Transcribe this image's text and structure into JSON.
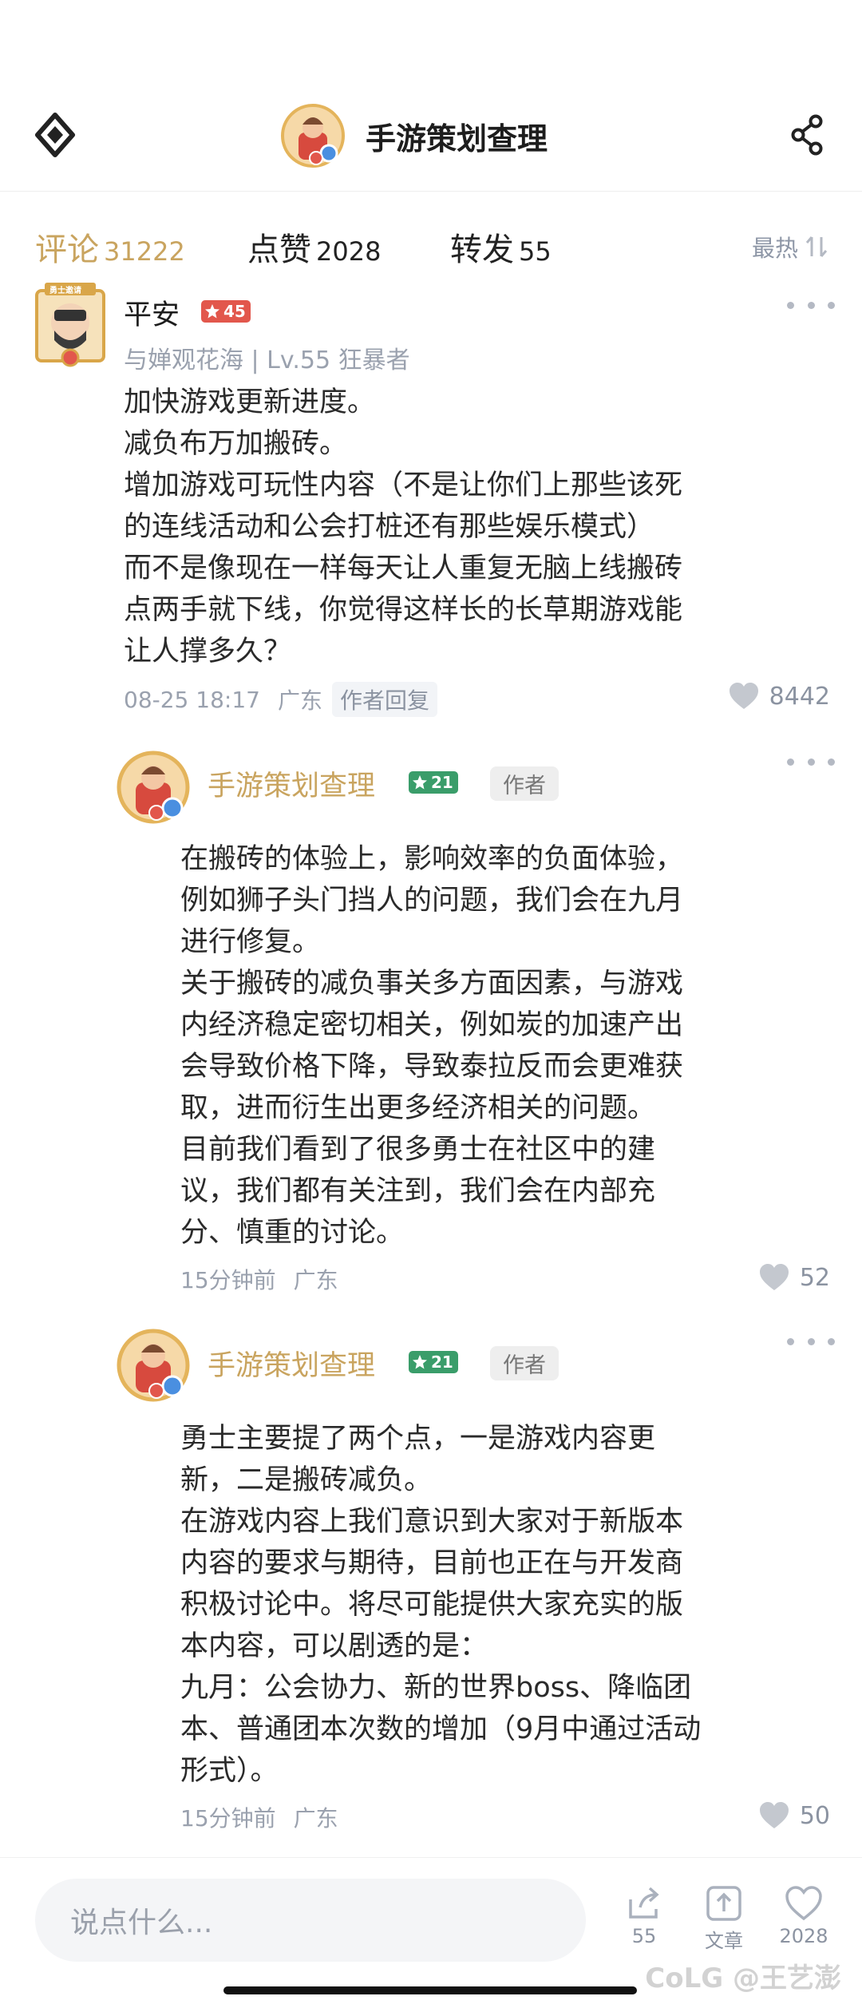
{
  "header": {
    "title": "手游策划查理",
    "back_icon": "diamond-logo-icon",
    "share_icon": "share-icon"
  },
  "tabs": [
    {
      "label": "评论",
      "count": "31222",
      "active": true
    },
    {
      "label": "点赞",
      "count": "2028",
      "active": false
    },
    {
      "label": "转发",
      "count": "55",
      "active": false
    }
  ],
  "sort_label": "最热",
  "colors": {
    "accent": "#c9a45f",
    "meta": "#9aa1ae",
    "badge_red": "#e2574c",
    "badge_green": "#3a9d6a"
  },
  "comment": {
    "username": "平安",
    "level_badge": "45",
    "avatar_banner": "勇士邀请",
    "sub": "与婵观花海 | Lv.55 狂暴者",
    "lines": [
      "加快游戏更新进度。",
      "减负布万加搬砖。",
      "增加游戏可玩性内容（不是让你们上那些该死",
      "的连线活动和公会打桩还有那些娱乐模式）",
      "而不是像现在一样每天让人重复无脑上线搬砖",
      "点两手就下线，你觉得这样长的长草期游戏能",
      "让人撑多久？"
    ],
    "time": "08-25 18:17",
    "region": "广东",
    "reply_tag": "作者回复",
    "likes": "8442"
  },
  "replies": [
    {
      "username": "手游策划查理",
      "level_badge": "21",
      "author_tag": "作者",
      "lines": [
        "在搬砖的体验上，影响效率的负面体验，",
        "例如狮子头门挡人的问题，我们会在九月",
        "进行修复。",
        "关于搬砖的减负事关多方面因素，与游戏",
        "内经济稳定密切相关，例如炭的加速产出",
        "会导致价格下降，导致泰拉反而会更难获",
        "取，进而衍生出更多经济相关的问题。",
        "目前我们看到了很多勇士在社区中的建",
        "议，我们都有关注到，我们会在内部充",
        "分、慎重的讨论。"
      ],
      "time": "15分钟前",
      "region": "广东",
      "likes": "52"
    },
    {
      "username": "手游策划查理",
      "level_badge": "21",
      "author_tag": "作者",
      "lines": [
        "勇士主要提了两个点，一是游戏内容更",
        "新，二是搬砖减负。",
        "在游戏内容上我们意识到大家对于新版本",
        "内容的要求与期待，目前也正在与开发商",
        "积极讨论中。将尽可能提供大家充实的版",
        "本内容，可以剧透的是：",
        "九月：公会协力、新的世界boss、降临团",
        "本、普通团本次数的增加（9月中通过活动",
        "形式）。"
      ],
      "time": "15分钟前",
      "region": "广东",
      "likes": "50"
    }
  ],
  "bottom_bar": {
    "placeholder": "说点什么...",
    "share_count": "55",
    "article_label": "文章",
    "like_count": "2028"
  },
  "watermark": "CoLG @王艺澎"
}
